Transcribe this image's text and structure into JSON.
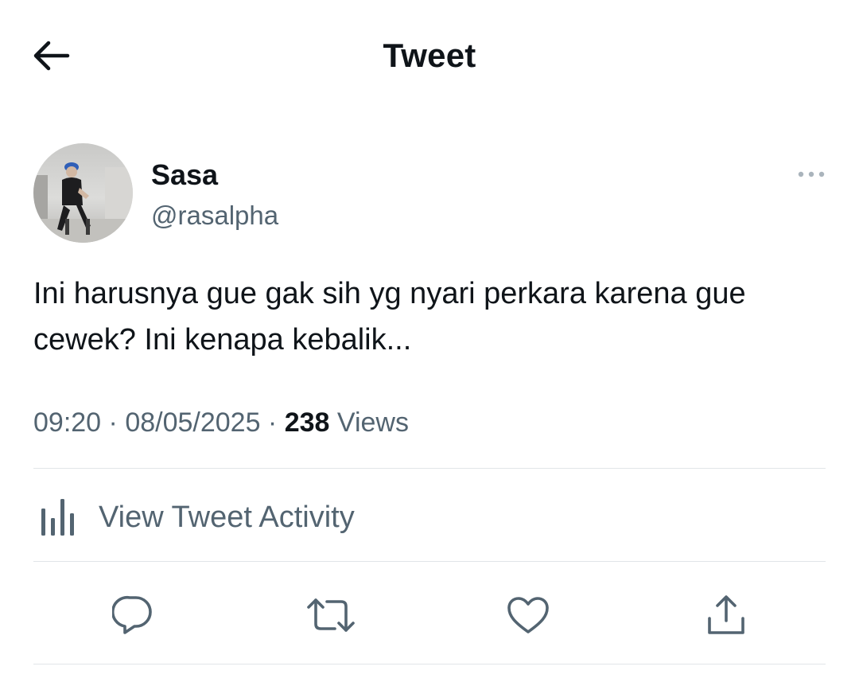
{
  "header": {
    "title": "Tweet",
    "back_icon": "arrow-left-icon"
  },
  "author": {
    "name": "Sasa",
    "handle": "@rasalpha",
    "more_icon": "more-dots-icon"
  },
  "tweet": {
    "text": "Ini harusnya gue gak sih yg nyari perkara karena gue cewek? Ini kenapa kebalik...",
    "time": "09:20",
    "date": "08/05/2025",
    "separator": " · ",
    "views_count": "238",
    "views_label": " Views"
  },
  "activity": {
    "label": "View Tweet Activity",
    "icon": "bar-chart-icon"
  },
  "actions": [
    {
      "name": "reply-icon"
    },
    {
      "name": "retweet-icon"
    },
    {
      "name": "like-icon"
    },
    {
      "name": "share-icon"
    }
  ],
  "colors": {
    "text_primary": "#0f1419",
    "text_secondary": "#536471",
    "divider": "#e1e5e8"
  }
}
